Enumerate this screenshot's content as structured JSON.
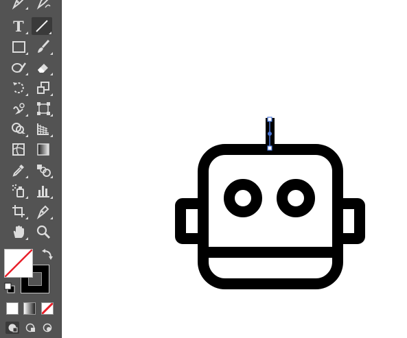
{
  "toolbar": {
    "tools": [
      {
        "name": "pen-tool",
        "icon": "pen-icon"
      },
      {
        "name": "curvature-tool",
        "icon": "curvature-pen-icon"
      },
      {
        "name": "type-tool",
        "icon": "type-icon"
      },
      {
        "name": "line-segment-tool",
        "icon": "line-segment-icon",
        "active": true
      },
      {
        "name": "rectangle-tool",
        "icon": "rectangle-icon"
      },
      {
        "name": "paintbrush-tool",
        "icon": "paintbrush-icon"
      },
      {
        "name": "shaper-tool",
        "icon": "shaper-icon"
      },
      {
        "name": "eraser-tool",
        "icon": "eraser-icon"
      },
      {
        "name": "rotate-tool",
        "icon": "rotate-icon"
      },
      {
        "name": "scale-tool",
        "icon": "scale-icon"
      },
      {
        "name": "warp-tool",
        "icon": "warp-icon"
      },
      {
        "name": "free-transform-tool",
        "icon": "free-transform-icon"
      },
      {
        "name": "shape-builder-tool",
        "icon": "shape-builder-icon"
      },
      {
        "name": "perspective-grid-tool",
        "icon": "perspective-grid-icon"
      },
      {
        "name": "mesh-tool",
        "icon": "mesh-icon"
      },
      {
        "name": "gradient-tool",
        "icon": "gradient-icon"
      },
      {
        "name": "eyedropper-tool",
        "icon": "eyedropper-icon"
      },
      {
        "name": "blend-tool",
        "icon": "blend-icon"
      },
      {
        "name": "symbol-sprayer-tool",
        "icon": "symbol-sprayer-icon"
      },
      {
        "name": "column-graph-tool",
        "icon": "column-graph-icon"
      },
      {
        "name": "artboard-tool",
        "icon": "artboard-icon"
      },
      {
        "name": "slice-tool",
        "icon": "slice-icon"
      },
      {
        "name": "hand-tool",
        "icon": "hand-icon"
      },
      {
        "name": "zoom-tool",
        "icon": "zoom-icon"
      }
    ],
    "type_tool_glyph": "T",
    "fill_color": "#ffffff",
    "stroke_color": "#000000",
    "none_slash_color": "#e8202a",
    "toolbar_bg": "#535353"
  },
  "canvas": {
    "artwork": "robot-head-icon",
    "stroke_color": "#000000",
    "selection_color": "#4a76d8",
    "background": "#ffffff"
  }
}
